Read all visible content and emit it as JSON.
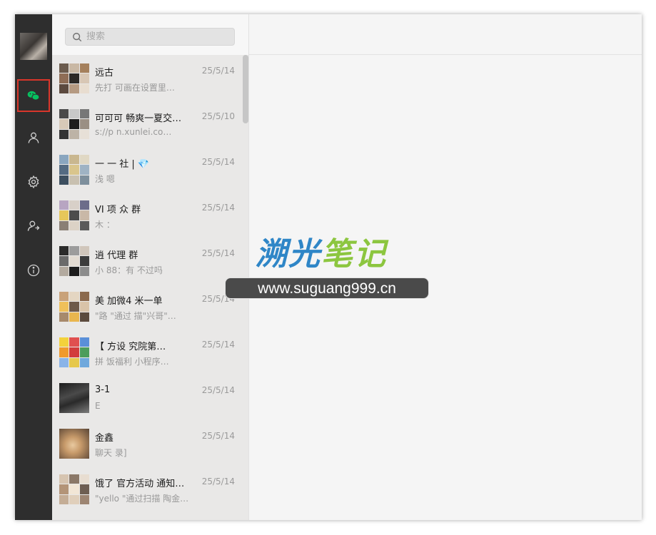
{
  "search": {
    "placeholder": "搜索"
  },
  "sidebar": {
    "items": [
      {
        "name": "chats",
        "icon": "chat-bubbles-icon",
        "active": true
      },
      {
        "name": "contacts",
        "icon": "person-icon",
        "active": false
      },
      {
        "name": "settings",
        "icon": "gear-icon",
        "active": false
      },
      {
        "name": "account",
        "icon": "person-switch-icon",
        "active": false
      },
      {
        "name": "about",
        "icon": "info-icon",
        "active": false
      }
    ]
  },
  "chats": [
    {
      "name": "远古",
      "preview": "先打 可画在设置里…",
      "time": "25/5/14"
    },
    {
      "name": "可可可 畅爽一夏交…",
      "preview": "s://p n.xunlei.co…",
      "time": "25/5/10"
    },
    {
      "name": "一 一 社 | 💎",
      "preview": "浅 嗯",
      "time": "25/5/14"
    },
    {
      "name": "VI 项 众 群",
      "preview": "木 ：",
      "time": "25/5/14"
    },
    {
      "name": "逍 代理 群",
      "preview": "小 88：有 不过吗",
      "time": "25/5/14"
    },
    {
      "name": "美 加微4 米一单",
      "preview": "\"路 \"通过 描\"兴哥\"…",
      "time": "25/5/14"
    },
    {
      "name": "【 方设 究院第…",
      "preview": "拼 饭福利 小程序…",
      "time": "25/5/14"
    },
    {
      "name": "3-1",
      "preview": "E",
      "time": "25/5/14"
    },
    {
      "name": "金鑫",
      "preview": "聊天 录]",
      "time": "25/5/14"
    },
    {
      "name": "饿了 官方活动 通知…",
      "preview": "\"yello \"通过扫描 陶金…",
      "time": "25/5/14"
    }
  ],
  "watermark": {
    "logo_part1": "溯光",
    "logo_part2": "笔记",
    "url": "www.suguang999.cn"
  },
  "colors": {
    "sidebar_bg": "#2e2e2e",
    "active_outline": "#d9362b",
    "chat_icon_green": "#07c160"
  }
}
